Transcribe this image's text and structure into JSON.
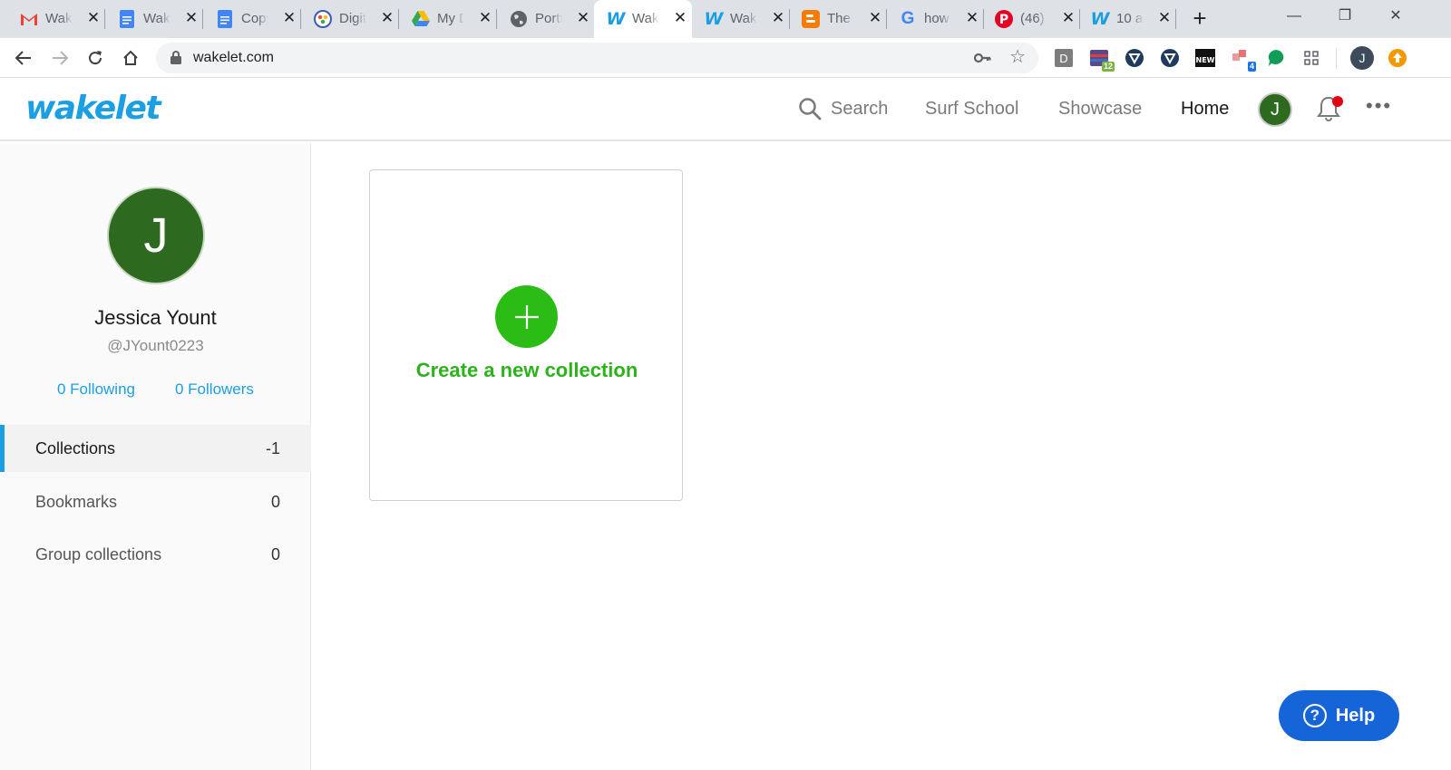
{
  "browser": {
    "tabs": [
      {
        "title": "Wakelet",
        "icon": "gmail-icon",
        "close": "✕"
      },
      {
        "title": "Wakelet",
        "icon": "docs-icon",
        "close": "✕"
      },
      {
        "title": "Copy",
        "icon": "docs-icon",
        "close": "✕"
      },
      {
        "title": "Digital",
        "icon": "digital-icon",
        "close": "✕"
      },
      {
        "title": "My Drive",
        "icon": "drive-icon",
        "close": "✕"
      },
      {
        "title": "Portfolio",
        "icon": "globe-icon",
        "close": "✕"
      },
      {
        "title": "Wakelet",
        "icon": "wakelet-icon",
        "close": "✕",
        "active": true
      },
      {
        "title": "Wakelet",
        "icon": "wakelet-icon",
        "close": "✕"
      },
      {
        "title": "The",
        "icon": "blogger-icon",
        "close": "✕"
      },
      {
        "title": "how",
        "icon": "google-icon",
        "close": "✕"
      },
      {
        "title": "(46)",
        "icon": "pinterest-icon",
        "close": "✕"
      },
      {
        "title": "10 a",
        "icon": "wakelet-icon",
        "close": "✕"
      }
    ],
    "new_tab": "+",
    "window_controls": {
      "minimize": "—",
      "restore": "❐",
      "close": "✕"
    },
    "url": "wakelet.com",
    "extensions": {
      "d_label": "D",
      "badge_12": "12",
      "badge_4": "4",
      "profile_initial": "J"
    }
  },
  "header": {
    "logo": "wakelet",
    "search": "Search",
    "surf_school": "Surf School",
    "showcase": "Showcase",
    "home": "Home",
    "avatar_initial": "J",
    "more": "•••"
  },
  "sidebar": {
    "avatar_initial": "J",
    "name": "Jessica Yount",
    "handle": "@JYount0223",
    "following": "0 Following",
    "followers": "0 Followers",
    "items": [
      {
        "label": "Collections",
        "count": "-1",
        "active": true
      },
      {
        "label": "Bookmarks",
        "count": "0"
      },
      {
        "label": "Group collections",
        "count": "0"
      }
    ]
  },
  "main": {
    "create_label": "Create a new collection"
  },
  "help": {
    "label": "Help",
    "icon_glyph": "?"
  },
  "colors": {
    "brand_blue": "#1b9fe2",
    "create_green": "#2cbc16",
    "avatar_green": "#2d6a1f",
    "help_blue": "#1565d8",
    "notification_red": "#e3000f"
  }
}
